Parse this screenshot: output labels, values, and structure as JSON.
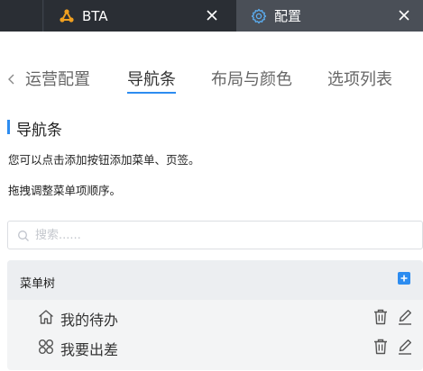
{
  "tabs": [
    {
      "label": "BTA",
      "icon": "bta-logo-icon",
      "active": false
    },
    {
      "label": "配置",
      "icon": "gear-icon",
      "active": true
    }
  ],
  "subtabs": {
    "items": [
      "运营配置",
      "导航条",
      "布局与颜色",
      "选项列表"
    ],
    "active": "导航条"
  },
  "section": {
    "title": "导航条",
    "hint1": "您可以点击添加按钮添加菜单、页签。",
    "hint2": "拖拽调整菜单项顺序。"
  },
  "search": {
    "placeholder": "搜索......",
    "value": ""
  },
  "menu_tree": {
    "title": "菜单树",
    "items": [
      {
        "label": "我的待办",
        "icon": "home-icon"
      },
      {
        "label": "我要出差",
        "icon": "grid-icon"
      }
    ]
  },
  "colors": {
    "accent": "#2d8cf0",
    "tabbar_bg": "#2f343b",
    "active_tab_bg": "#4a4f57",
    "logo_orange": "#f0a020"
  }
}
